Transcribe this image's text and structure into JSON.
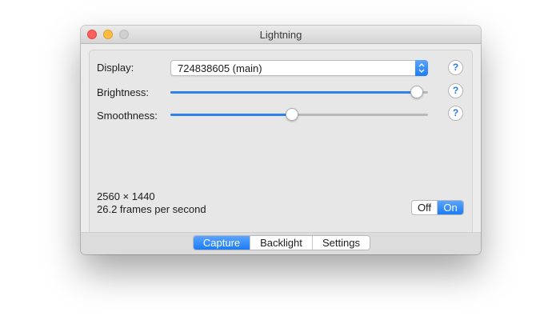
{
  "window": {
    "title": "Lightning"
  },
  "display": {
    "label": "Display:",
    "value": "724838605 (main)"
  },
  "brightness": {
    "label": "Brightness:",
    "level": 0.98
  },
  "smoothness": {
    "label": "Smoothness:",
    "level": 0.47
  },
  "help_label": "?",
  "info": {
    "resolution": "2560 × 1440",
    "framerate": "26.2 frames per second"
  },
  "toggle": {
    "off_label": "Off",
    "on_label": "On",
    "selected": "On"
  },
  "tabs": [
    {
      "label": "Capture",
      "selected": true
    },
    {
      "label": "Backlight",
      "selected": false
    },
    {
      "label": "Settings",
      "selected": false
    }
  ],
  "colors": {
    "accent": "#2f82ee",
    "close": "#fc605b",
    "minimize": "#fdbc40",
    "zoom_inactive": "#cfcfcf"
  },
  "icons": {
    "stepper": "up-down-chevron-icon",
    "help": "question-mark-icon"
  }
}
